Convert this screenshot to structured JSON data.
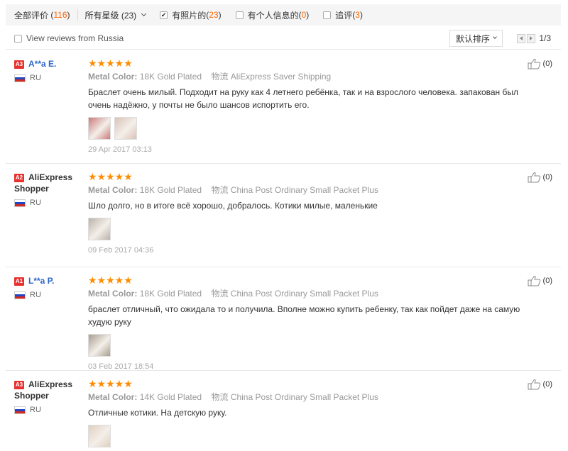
{
  "filters": {
    "all": {
      "label": "全部评价",
      "count": "116"
    },
    "stars": {
      "label": "所有星级 (23)"
    },
    "photos": {
      "label": "有照片的",
      "count": "23",
      "checked": true
    },
    "info": {
      "label": "有个人信息的",
      "count": "0",
      "checked": false
    },
    "followup": {
      "label": "追评",
      "count": "3",
      "checked": false
    }
  },
  "russia_toggle": {
    "label": "View reviews from Russia",
    "checked": false
  },
  "sort": {
    "label": "默认排序"
  },
  "pagination": {
    "page": "1/3"
  },
  "reviews": [
    {
      "level": "A3",
      "user": "A**a E.",
      "user_is_link": true,
      "country": "RU",
      "rating": 5,
      "stars": "★★★★★",
      "color_label": "Metal Color:",
      "color_value": "18K Gold Plated",
      "shipping_label": "物流",
      "shipping_value": "AliExpress Saver Shipping",
      "text": "Браслет очень милый. Подходит на руку как 4 летнего ребёнка, так и на взрослого человека. запакован был очень надёжно, у почты не было шансов испортить его.",
      "photos": 2,
      "date": "29 Apr 2017 03:13",
      "helpful": "(0)"
    },
    {
      "level": "A2",
      "user": "AliExpress Shopper",
      "user_is_link": false,
      "country": "RU",
      "rating": 5,
      "stars": "★★★★★",
      "color_label": "Metal Color:",
      "color_value": "18K Gold Plated",
      "shipping_label": "物流",
      "shipping_value": "China Post Ordinary Small Packet Plus",
      "text": "Шло долго, но в итоге всё хорошо, добралось. Котики милые, маленькие",
      "photos": 1,
      "date": "09 Feb 2017 04:36",
      "helpful": "(0)"
    },
    {
      "level": "A1",
      "user": "L**a P.",
      "user_is_link": true,
      "country": "RU",
      "rating": 5,
      "stars": "★★★★★",
      "color_label": "Metal Color:",
      "color_value": "18K Gold Plated",
      "shipping_label": "物流",
      "shipping_value": "China Post Ordinary Small Packet Plus",
      "text": "браслет отличный, что ожидала то и получила. Вполне можно купить ребенку, так как пойдет даже на самую худую руку",
      "photos": 1,
      "date": "03 Feb 2017 18:54",
      "helpful": "(0)"
    },
    {
      "level": "A3",
      "user": "AliExpress Shopper",
      "user_is_link": false,
      "country": "RU",
      "rating": 5,
      "stars": "★★★★★",
      "color_label": "Metal Color:",
      "color_value": "14K Gold Plated",
      "shipping_label": "物流",
      "shipping_value": "China Post Ordinary Small Packet Plus",
      "text": "Отличные котики. На детскую руку.",
      "photos": 1,
      "date": "",
      "helpful": "(0)"
    }
  ],
  "colors": {
    "accent_orange": "#ff8c00",
    "count_orange": "#ff6600",
    "level_red": "#e8312f",
    "link_blue": "#2b65c8"
  }
}
